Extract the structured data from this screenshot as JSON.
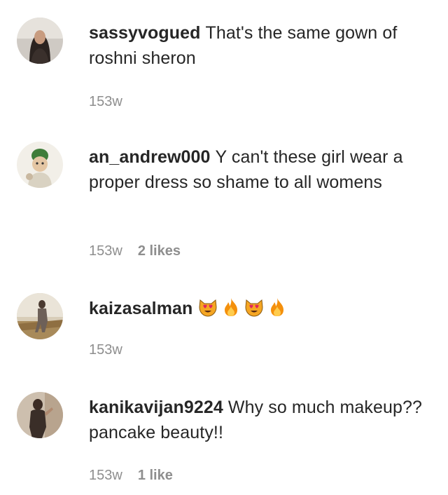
{
  "comments": [
    {
      "username": "sassyvogued",
      "text": "That's the same gown of roshni sheron",
      "time": "153w",
      "likes": ""
    },
    {
      "username": "an_andrew000",
      "text": "Y can't these girl wear a proper dress so shame to all womens",
      "time": "153w",
      "likes": "2 likes"
    },
    {
      "username": "kaizasalman",
      "text": "",
      "emojis": [
        "heart-eyes-cat-icon",
        "fire-icon",
        "heart-eyes-cat-icon",
        "fire-icon"
      ],
      "time": "153w",
      "likes": ""
    },
    {
      "username": "kanikavijan9224",
      "text": "Why so much makeup??pancake beauty!!",
      "time": "153w",
      "likes": "1 like"
    }
  ],
  "colors": {
    "text": "#262626",
    "meta": "#8e8e8e",
    "background": "#ffffff"
  }
}
